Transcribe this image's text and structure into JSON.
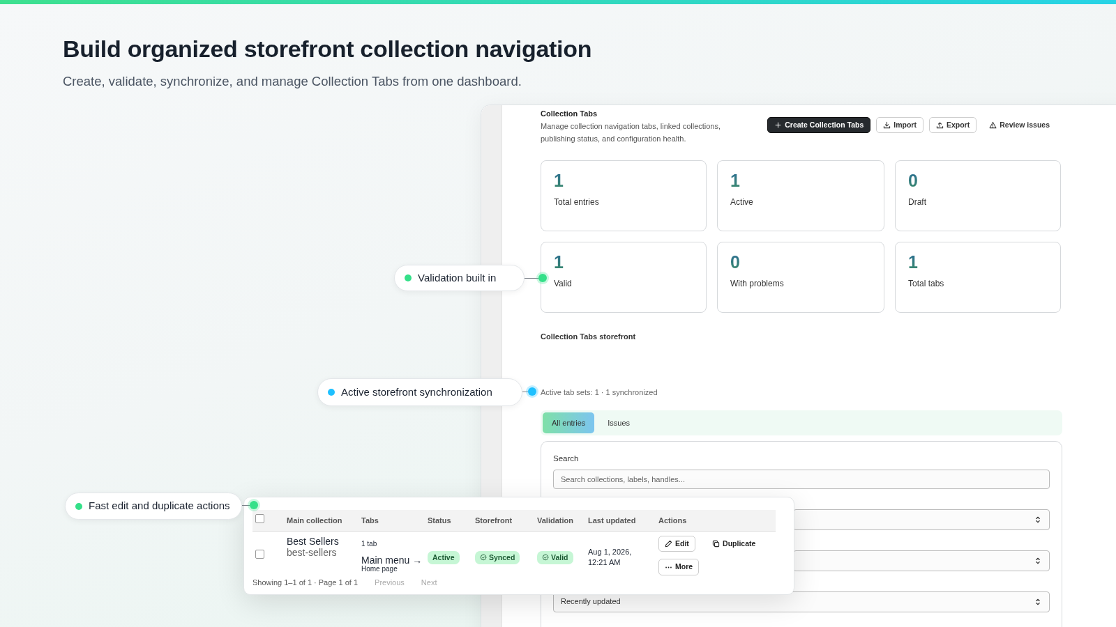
{
  "hero": {
    "title": "Build organized storefront collection navigation",
    "subtitle": "Create, validate, synchronize, and manage Collection Tabs from one dashboard."
  },
  "panel": {
    "title": "Collection Tabs",
    "description": "Manage collection navigation tabs, linked collections, publishing status, and configuration health.",
    "actions": [
      {
        "label": "Create Collection Tabs",
        "kind": "primary"
      },
      {
        "label": "Import",
        "kind": "outline"
      },
      {
        "label": "Export",
        "kind": "outline"
      },
      {
        "label": "Review issues",
        "kind": "plain"
      }
    ],
    "stats": [
      {
        "value": "1",
        "label": "Total entries"
      },
      {
        "value": "1",
        "label": "Active"
      },
      {
        "value": "0",
        "label": "Draft"
      },
      {
        "value": "1",
        "label": "Valid"
      },
      {
        "value": "0",
        "label": "With problems"
      },
      {
        "value": "1",
        "label": "Total tabs"
      }
    ],
    "storefront_heading": "Collection Tabs storefront",
    "sync_status": "Active tab sets: 1 · 1 synchronized",
    "tabs": [
      {
        "label": "All entries",
        "selected": true
      },
      {
        "label": "Issues",
        "selected": false
      }
    ],
    "filters": {
      "search_label": "Search",
      "search_placeholder": "Search collections, labels, handles...",
      "sort_value": "Recently updated"
    }
  },
  "table": {
    "header_checked": false,
    "columns": [
      "Main collection",
      "Tabs",
      "Status",
      "Storefront",
      "Validation",
      "Last updated",
      "Actions"
    ],
    "rows": [
      {
        "checked": false,
        "collection": "Best Sellers",
        "handle": "best-sellers",
        "tab_count": "1 tab",
        "menu": "Main menu →",
        "menu_target": "Home page",
        "status": "Active",
        "storefront": "Synced",
        "validation": "Valid",
        "updated": "Aug 1, 2026, 12:21 AM",
        "actions": [
          "Edit",
          "Duplicate",
          "More"
        ]
      }
    ],
    "footer": "Showing 1–1 of 1 · Page 1 of 1",
    "pagination": [
      {
        "label": "Previous",
        "disabled": true
      },
      {
        "label": "Next",
        "disabled": true
      }
    ]
  },
  "callouts": [
    {
      "label": "Validation built in",
      "color": "#34e089"
    },
    {
      "label": "Active storefront synchronization",
      "color": "#1ec0ff"
    },
    {
      "label": "Fast edit and duplicate actions",
      "color": "#34e089"
    }
  ]
}
